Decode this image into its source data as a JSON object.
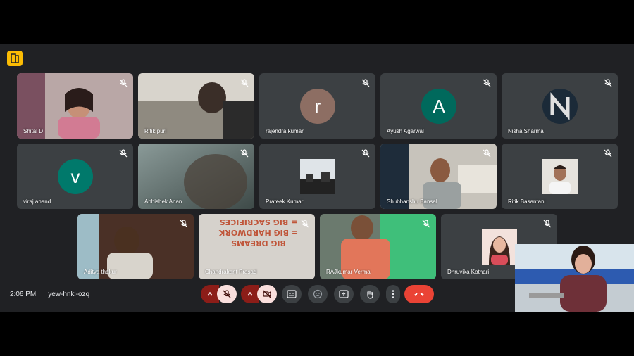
{
  "meeting": {
    "time": "2:06 PM",
    "code": "yew-hnki-ozq"
  },
  "participants": [
    {
      "name": "Shital D"
    },
    {
      "name": "Ritik puri"
    },
    {
      "name": "rajendra kumar",
      "initial": "r",
      "color": "#8d6e63"
    },
    {
      "name": "Ayush Agarwal",
      "initial": "A",
      "color": "#00695c"
    },
    {
      "name": "Nisha Sharma"
    },
    {
      "name": "viraj anand",
      "initial": "v",
      "color": "#00796b"
    },
    {
      "name": "Abhishek Anan"
    },
    {
      "name": "Prateek Kumar"
    },
    {
      "name": "Shubhanshu Bansal"
    },
    {
      "name": "Ritik Basantani"
    },
    {
      "name": "Aditya thakur"
    },
    {
      "name": "Chandrakant Prasad"
    },
    {
      "name": "RAJkumar Verma"
    },
    {
      "name": "Dhruvika Kothari"
    }
  ],
  "poster": {
    "line1": "BIG DREAMS",
    "line2": "= BIG HARDWORK",
    "line3": "= BIG SACRIFICES"
  },
  "controls": {
    "mic_state": "muted",
    "camera_state": "off"
  },
  "colors": {
    "tile": "#3c4043",
    "background": "#202124",
    "end_call": "#ea4335",
    "muted_bg": "#f9dedc"
  }
}
